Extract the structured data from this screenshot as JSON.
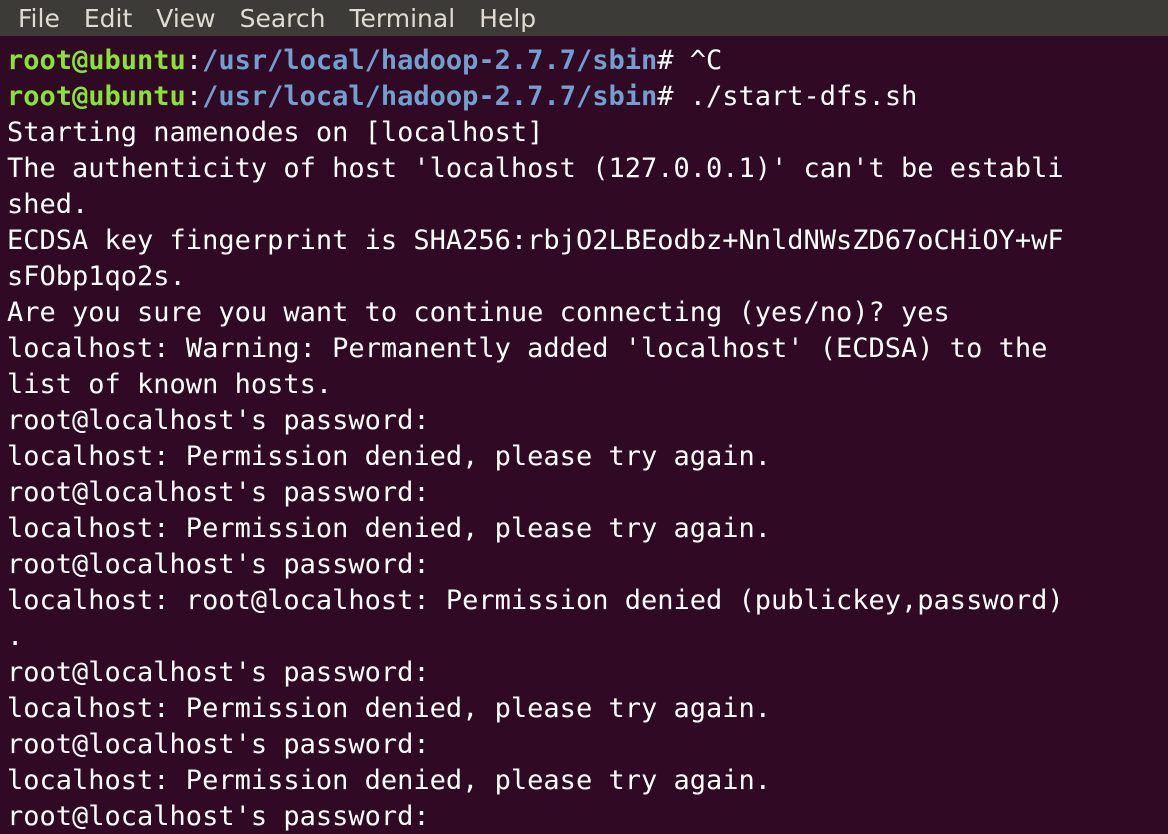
{
  "menu": [
    "File",
    "Edit",
    "View",
    "Search",
    "Terminal",
    "Help"
  ],
  "terminal": {
    "prompt_lines": [
      {
        "user": "root@ubuntu",
        "sep": ":",
        "path": "/usr/local/hadoop-2.7.7/sbin",
        "suffix": "# ",
        "command": "^C"
      },
      {
        "user": "root@ubuntu",
        "sep": ":",
        "path": "/usr/local/hadoop-2.7.7/sbin",
        "suffix": "# ",
        "command": "./start-dfs.sh"
      }
    ],
    "output": [
      "Starting namenodes on [localhost]",
      "The authenticity of host 'localhost (127.0.0.1)' can't be establi",
      "shed.",
      "ECDSA key fingerprint is SHA256:rbjO2LBEodbz+NnldNWsZD67oCHiOY+wF",
      "sFObp1qo2s.",
      "Are you sure you want to continue connecting (yes/no)? yes",
      "localhost: Warning: Permanently added 'localhost' (ECDSA) to the",
      "list of known hosts.",
      "root@localhost's password:",
      "localhost: Permission denied, please try again.",
      "root@localhost's password:",
      "localhost: Permission denied, please try again.",
      "root@localhost's password:",
      "localhost: root@localhost: Permission denied (publickey,password)",
      ".",
      "root@localhost's password:",
      "localhost: Permission denied, please try again.",
      "root@localhost's password:",
      "localhost: Permission denied, please try again.",
      "root@localhost's password:"
    ]
  },
  "colors": {
    "background": "#300a24",
    "menubar": "#3c3b37",
    "user": "#8ae234",
    "path": "#729fcf",
    "text": "#ffffff"
  }
}
